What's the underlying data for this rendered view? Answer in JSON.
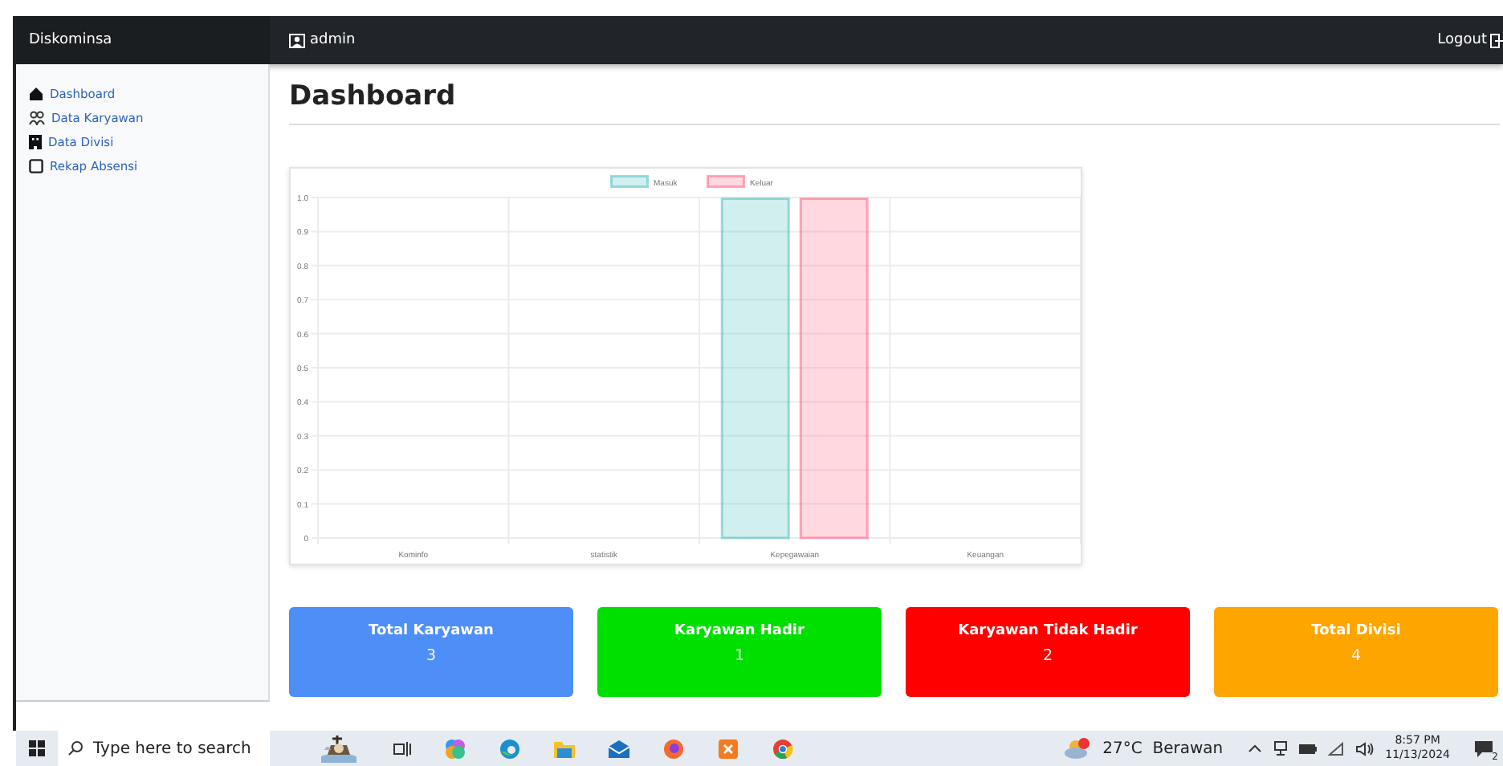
{
  "topbar": {
    "brand": "Diskominsa",
    "user": "admin",
    "logout": "Logout"
  },
  "sidebar": {
    "items": [
      {
        "label": "Dashboard"
      },
      {
        "label": "Data Karyawan"
      },
      {
        "label": "Data Divisi"
      },
      {
        "label": "Rekap Absensi"
      }
    ]
  },
  "page_title": "Dashboard",
  "chart_data": {
    "type": "bar",
    "grid": true,
    "legend": true,
    "categories": [
      "Kominfo",
      "statistik",
      "Kepegawaian",
      "Keuangan"
    ],
    "ylim": [
      0,
      1
    ],
    "yticks": [
      0,
      0.1,
      0.2,
      0.3,
      0.4,
      0.5,
      0.6,
      0.7,
      0.8,
      0.9,
      {
        "value": 1,
        "label": "1.0"
      }
    ],
    "series": [
      {
        "name": "Masuk",
        "color": "#4bc0c0",
        "values": [
          0,
          0,
          1,
          0
        ]
      },
      {
        "name": "Keluar",
        "color": "#ff6384",
        "values": [
          0,
          0,
          1,
          0
        ]
      }
    ]
  },
  "stats": [
    {
      "label": "Total Karyawan",
      "value": "3",
      "color": "#4e8ef7"
    },
    {
      "label": "Karyawan Hadir",
      "value": "1",
      "color": "#00e000"
    },
    {
      "label": "Karyawan Tidak Hadir",
      "value": "2",
      "color": "#ff0000"
    },
    {
      "label": "Total Divisi",
      "value": "4",
      "color": "#ffa500"
    }
  ],
  "taskbar": {
    "search_placeholder": "Type here to search",
    "weather": "27°C  Berawan",
    "time": "8:57 PM",
    "date": "11/13/2024",
    "notifications": "2"
  }
}
